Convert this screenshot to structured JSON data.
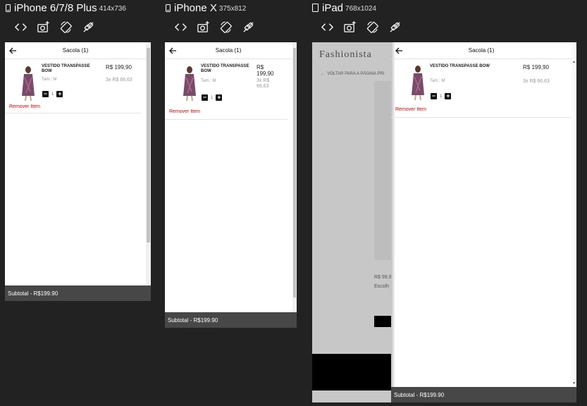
{
  "devices": [
    {
      "name": "iPhone 6/7/8 Plus",
      "size": "414x736",
      "icon": "phone-icon"
    },
    {
      "name": "iPhone X",
      "size": "375x812",
      "icon": "phone-icon"
    },
    {
      "name": "iPad",
      "size": "768x1024",
      "icon": "tablet-icon"
    }
  ],
  "toolbar_icons": [
    "code-icon",
    "screenshot-icon",
    "rotate-icon",
    "disconnect-icon"
  ],
  "cart": {
    "title": "Sacola (1)",
    "item": {
      "name": "VESTIDO TRANSPASSE BOW",
      "size": "Tam.: M",
      "price": "R$ 199,90",
      "installments": "3x R$ 66,63",
      "quantity": "1"
    },
    "remove_label": "Remover Item",
    "subtotal": "Subtotal - R$199.90"
  },
  "ipad_background": {
    "brand": "Fashionista",
    "back_link": "VOLTAR PARA A PÁGINA PRI",
    "price": "R$ 99,9",
    "choose": "Escolh"
  }
}
